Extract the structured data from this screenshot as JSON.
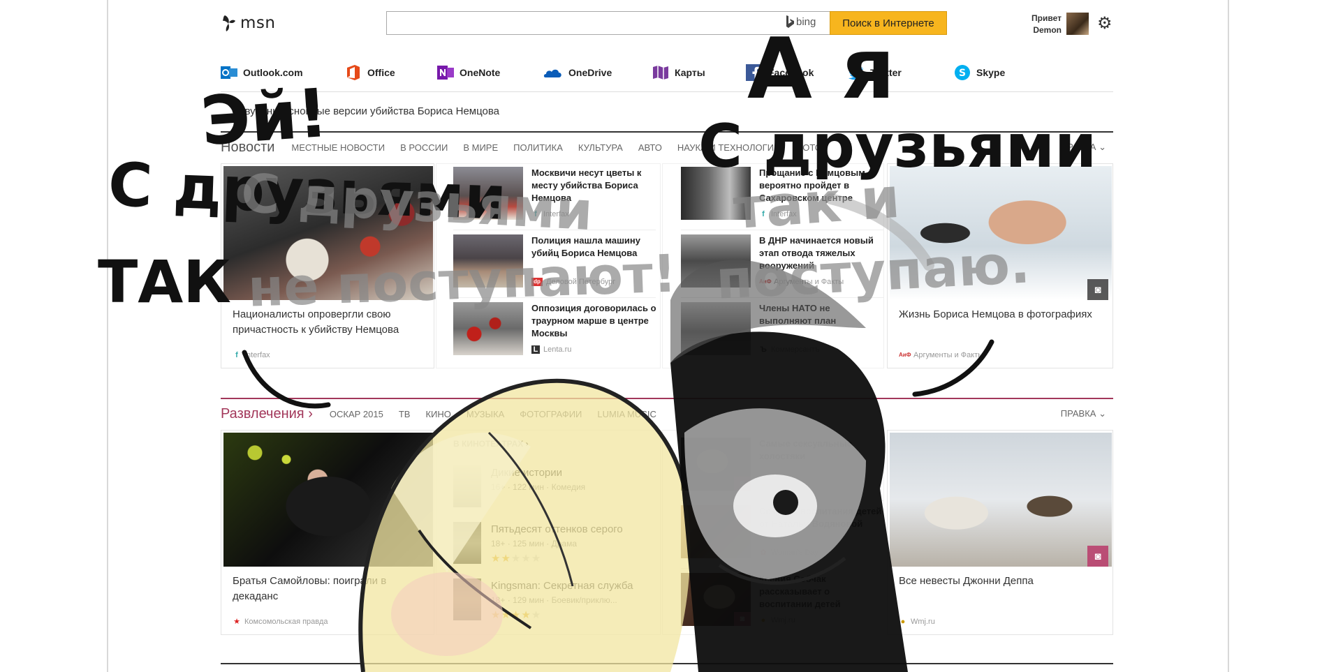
{
  "header": {
    "logo_text": "msn",
    "search_placeholder": "",
    "bing_label": "bing",
    "search_button": "Поиск в Интернете",
    "greeting_line1": "Привет",
    "greeting_line2": "Demon"
  },
  "apps": [
    {
      "label": "Outlook.com",
      "icon": "outlook-icon",
      "color": "#0072c6"
    },
    {
      "label": "Office",
      "icon": "office-icon",
      "color": "#e64a19"
    },
    {
      "label": "OneNote",
      "icon": "onenote-icon",
      "color": "#7719aa"
    },
    {
      "label": "OneDrive",
      "icon": "onedrive-icon",
      "color": "#0a5cb8"
    },
    {
      "label": "Карты",
      "icon": "maps-icon",
      "color": "#7a3b9e"
    },
    {
      "label": "Facebook",
      "icon": "facebook-icon",
      "color": "#3b5998"
    },
    {
      "label": "Twitter",
      "icon": "twitter-icon",
      "color": "#1da1f2"
    },
    {
      "label": "Skype",
      "icon": "skype-icon",
      "color": "#00aff0"
    }
  ],
  "headline": "Озвучены основные версии убийства Бориса Немцова",
  "news": {
    "title": "Новости",
    "tabs": [
      "МЕСТНЫЕ НОВОСТИ",
      "В РОССИИ",
      "В МИРЕ",
      "ПОЛИТИКА",
      "КУЛЬТУРА",
      "АВТО",
      "НАУКА И ТЕХНОЛОГИИ",
      "ФОТО"
    ],
    "edit": "ПРАВКА",
    "accent": "#333333",
    "lead": {
      "caption": "Националисты опровергли свою причастность к убийству Немцова",
      "source": "Interfax"
    },
    "col2": [
      {
        "title": "Москвичи несут цветы к месту убийства Бориса Немцова",
        "source": "Interfax",
        "src_icon": "f"
      },
      {
        "title": "Полиция нашла машину убийц Бориса Немцова",
        "source": "Деловой Петербург",
        "src_icon": "dp"
      },
      {
        "title": "Оппозиция договорилась о траурном марше в центре Москвы",
        "source": "Lenta.ru",
        "src_icon": "L"
      }
    ],
    "col3": [
      {
        "title": "Прощание с Немцовым вероятно пройдет в Сахаровском центре",
        "source": "Interfax",
        "src_icon": "f"
      },
      {
        "title": "В ДНР начинается новый этап отвода тяжелых вооружений",
        "source": "Аргументы и Факты",
        "src_icon": "АиФ"
      },
      {
        "title": "Члены НАТО не выполняют план",
        "source": "Коммерсантъ",
        "src_icon": "Ъ"
      }
    ],
    "gallery": {
      "caption": "Жизнь Бориса Немцова в фотографиях",
      "source": "Аргументы и Факты"
    }
  },
  "entertainment": {
    "title": "Развлечения",
    "tabs": [
      "ОСКАР 2015",
      "ТВ",
      "КИНО",
      "МУЗЫКА",
      "ФОТОГРАФИИ",
      "LUMIA MUSIC"
    ],
    "edit": "ПРАВКА",
    "accent": "#a2375a",
    "lead": {
      "caption": "Братья Самойловы: поиграли в декаданс",
      "source": "Комсомольская правда"
    },
    "movies_head": "В КИНОТЕАТРАХ",
    "movies": [
      {
        "title": "Дикие истории",
        "meta": "16+ · 122 мин · Комедия",
        "rating": 0
      },
      {
        "title": "Пятьдесят оттенков серого",
        "meta": "18+ · 125 мин · Драма",
        "rating": 2
      },
      {
        "title": "Kingsman: Секретная служба",
        "meta": "18+ · 129 мин · Боевик/приклю...",
        "rating": 4
      }
    ],
    "col3": [
      {
        "title": "Самые сексуальные холостяки",
        "source": "Wmj.ru"
      },
      {
        "title": "Секреты воспитания детей от Натальи Водяновой",
        "source": "Woman's Day"
      },
      {
        "title": "Ксения Собчак рассказывает о воспитании детей",
        "source": "Wmj.ru"
      }
    ],
    "gallery": {
      "caption": "Все невесты Джонни Деппа",
      "source": "Wmj.ru"
    }
  },
  "overlay": {
    "left_line1": "Эй!",
    "left_line2": "С друзьями",
    "left_line3": "ТАК",
    "left_gray1": "С друзьями",
    "left_gray2": "не поступают!",
    "right_line1": "А я",
    "right_line2": "С друзьями",
    "right_gray1": "так и",
    "right_gray2": "поступаю."
  }
}
